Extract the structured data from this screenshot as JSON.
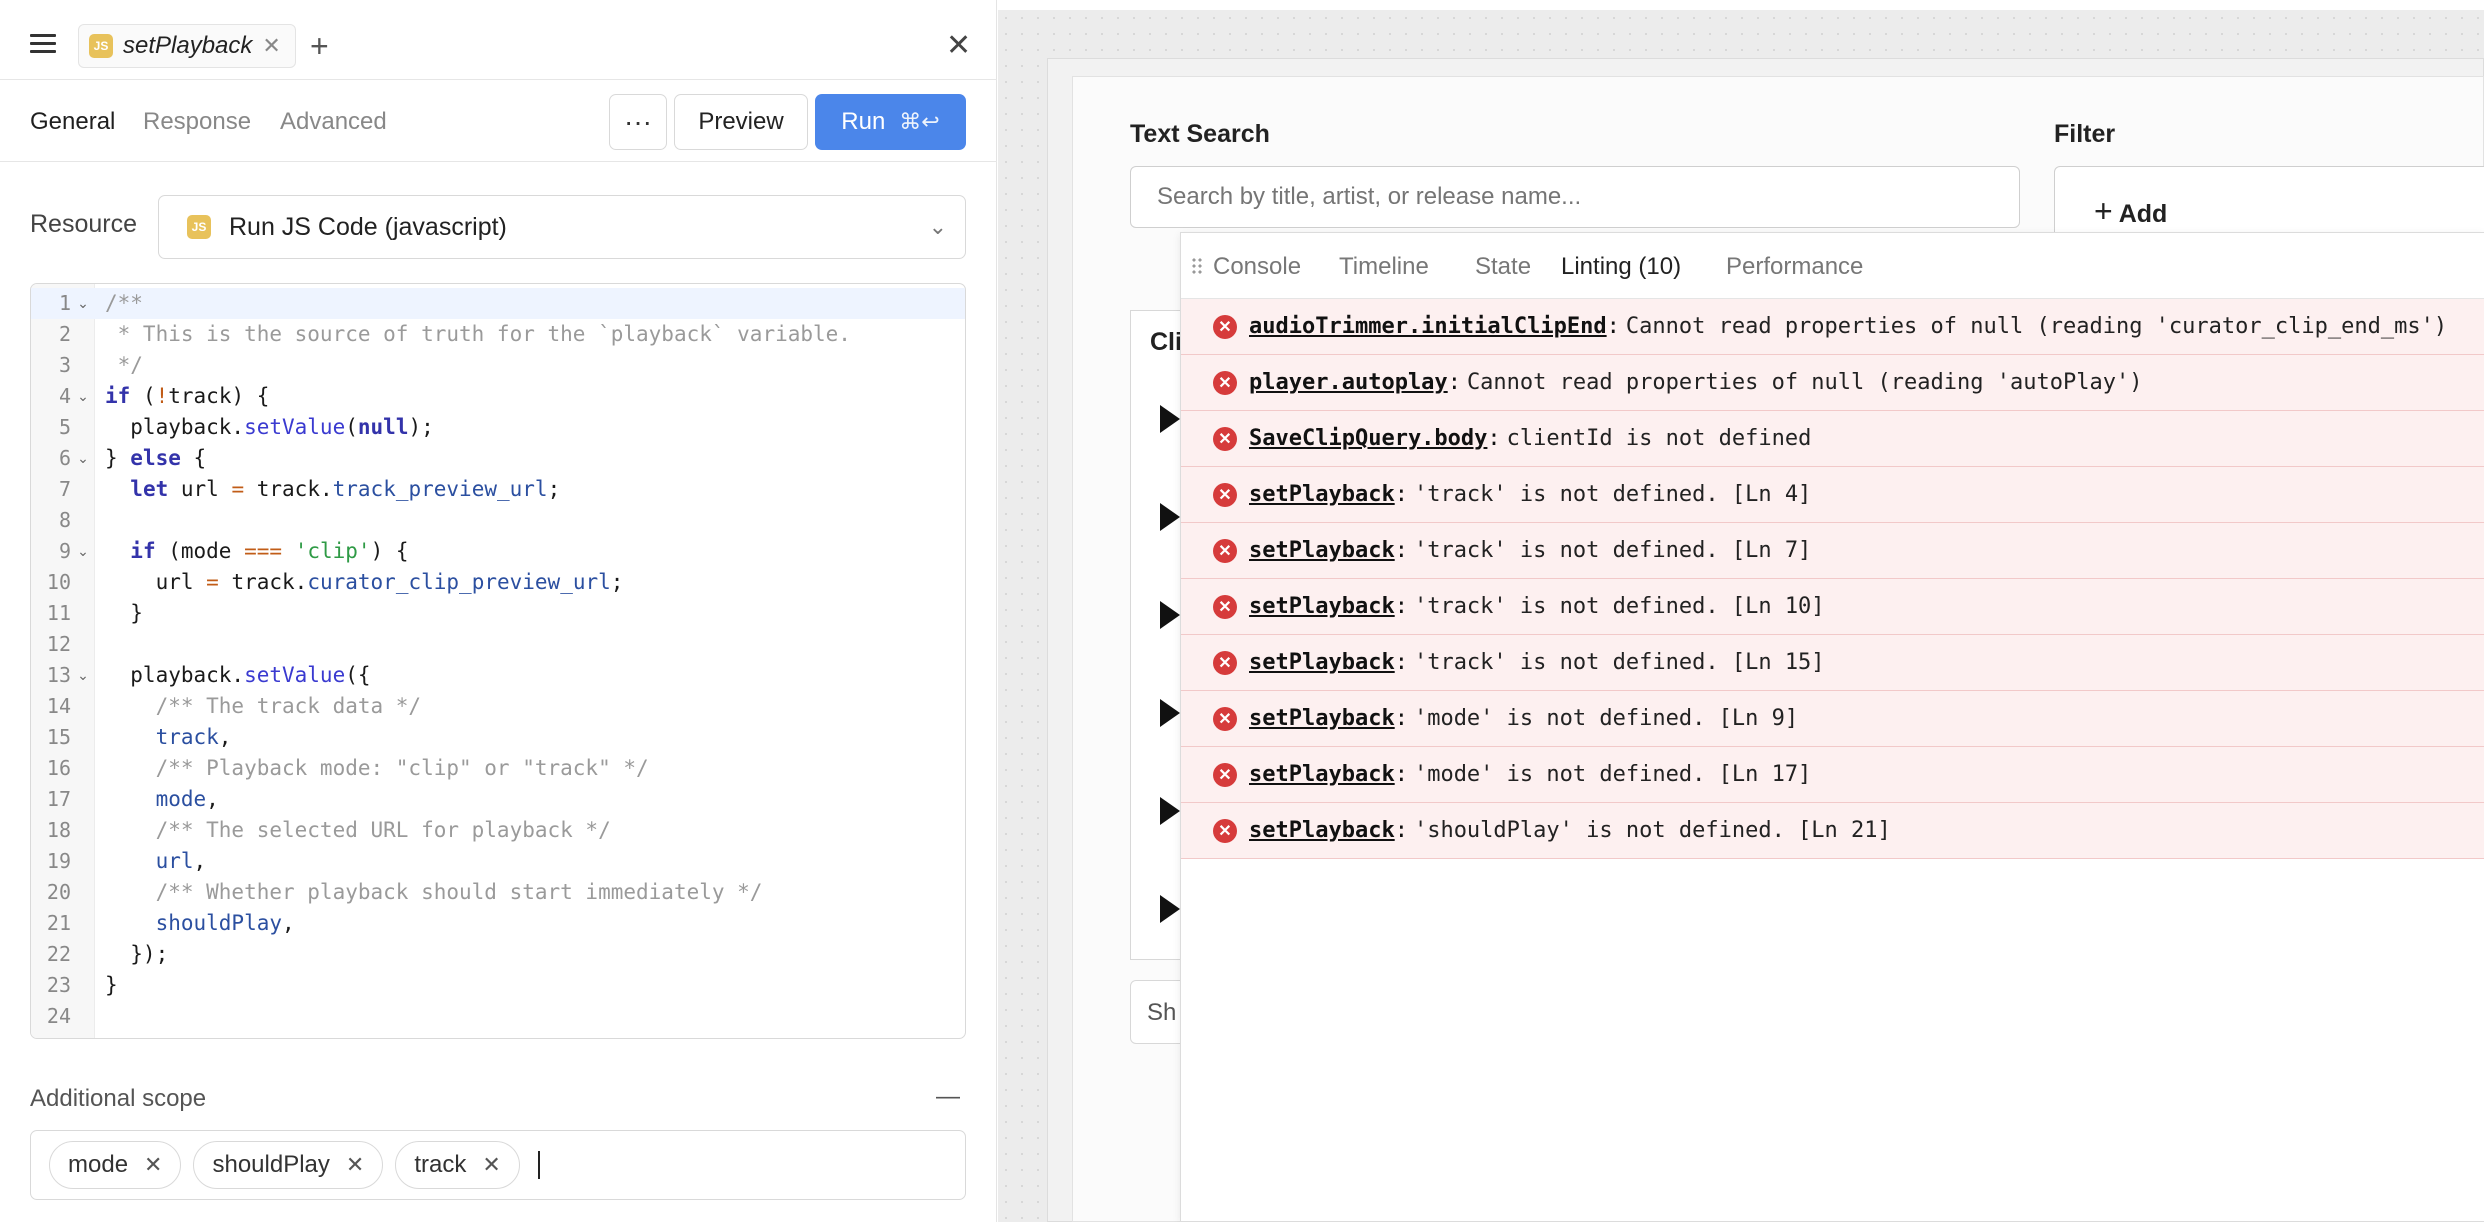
{
  "tab": {
    "badge": "JS",
    "title": "setPlayback"
  },
  "subnav": {
    "tabs": [
      "General",
      "Response",
      "Advanced"
    ],
    "more": "···",
    "preview": "Preview",
    "run": "Run",
    "run_shortcut": "⌘↩"
  },
  "resource": {
    "label": "Resource",
    "badge": "JS",
    "value": "Run JS Code (javascript)"
  },
  "editor": {
    "line_numbers": [
      "1",
      "2",
      "3",
      "4",
      "5",
      "6",
      "7",
      "8",
      "9",
      "10",
      "11",
      "12",
      "13",
      "14",
      "15",
      "16",
      "17",
      "18",
      "19",
      "20",
      "21",
      "22",
      "23",
      "24"
    ],
    "fold_lines": [
      1,
      4,
      6,
      9,
      13
    ]
  },
  "scope": {
    "label": "Additional scope",
    "collapse": "—",
    "chips": [
      "mode",
      "shouldPlay",
      "track"
    ]
  },
  "canvas": {
    "search_label": "Text Search",
    "search_placeholder": "Search by title, artist, or release name...",
    "filter_label": "Filter",
    "add_label": "Add",
    "table_head_fragment": "Cli",
    "footer_fragment": "Sh"
  },
  "debugger": {
    "tabs": [
      "Console",
      "Timeline",
      "State",
      "Linting (10)",
      "Performance"
    ],
    "active_tab": "Linting (10)",
    "errors": [
      {
        "source": "audioTrimmer.initialClipEnd",
        "message": "Cannot read properties of null (reading 'curator_clip_end_ms')"
      },
      {
        "source": "player.autoplay",
        "message": "Cannot read properties of null (reading 'autoPlay')"
      },
      {
        "source": "SaveClipQuery.body",
        "message": "clientId is not defined"
      },
      {
        "source": "setPlayback",
        "message": "'track' is not defined. [Ln 4]"
      },
      {
        "source": "setPlayback",
        "message": "'track' is not defined. [Ln 7]"
      },
      {
        "source": "setPlayback",
        "message": "'track' is not defined. [Ln 10]"
      },
      {
        "source": "setPlayback",
        "message": "'track' is not defined. [Ln 15]"
      },
      {
        "source": "setPlayback",
        "message": "'mode' is not defined. [Ln 9]"
      },
      {
        "source": "setPlayback",
        "message": "'mode' is not defined. [Ln 17]"
      },
      {
        "source": "setPlayback",
        "message": "'shouldPlay' is not defined. [Ln 21]"
      }
    ]
  },
  "colors": {
    "accent": "#4b86ea",
    "error": "#d63b3b",
    "error_bg": "#fdf0f0",
    "js_badge": "#e8c25b"
  }
}
